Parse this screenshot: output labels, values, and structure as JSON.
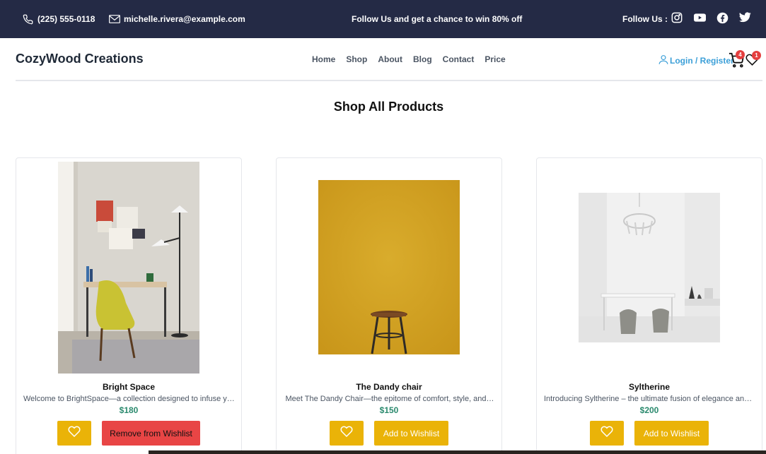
{
  "topbar": {
    "phone": "(225) 555-0118",
    "email": "michelle.rivera@example.com",
    "promo": "Follow Us and get a chance to win 80% off",
    "follow_label": "Follow Us :",
    "social_icons": [
      "instagram-icon",
      "youtube-icon",
      "facebook-icon",
      "twitter-icon"
    ]
  },
  "header": {
    "brand": "CozyWood Creations",
    "nav": [
      "Home",
      "Shop",
      "About",
      "Blog",
      "Contact",
      "Price"
    ],
    "login": "Login / Register",
    "cart_count": "4",
    "wishlist_count": "1"
  },
  "main": {
    "title": "Shop All Products",
    "products": [
      {
        "name": "Bright Space",
        "description": "Welcome to BrightSpace—a collection designed to infuse your…",
        "price": "$180",
        "wishlist_label": "Remove from Wishlist",
        "in_wishlist": true
      },
      {
        "name": "The Dandy chair",
        "description": "Meet The Dandy Chair—the epitome of comfort, style, and…",
        "price": "$150",
        "wishlist_label": "Add to Wishlist",
        "in_wishlist": false
      },
      {
        "name": "Syltherine",
        "description": "Introducing Syltherine – the ultimate fusion of elegance and power…",
        "price": "$200",
        "wishlist_label": "Add to Wishlist",
        "in_wishlist": false
      }
    ]
  },
  "colors": {
    "topbar_bg": "#242a45",
    "accent_yellow": "#eab308",
    "remove_red": "#e84545",
    "price_green": "#2b8a6e",
    "link_blue": "#3b9fd8"
  }
}
